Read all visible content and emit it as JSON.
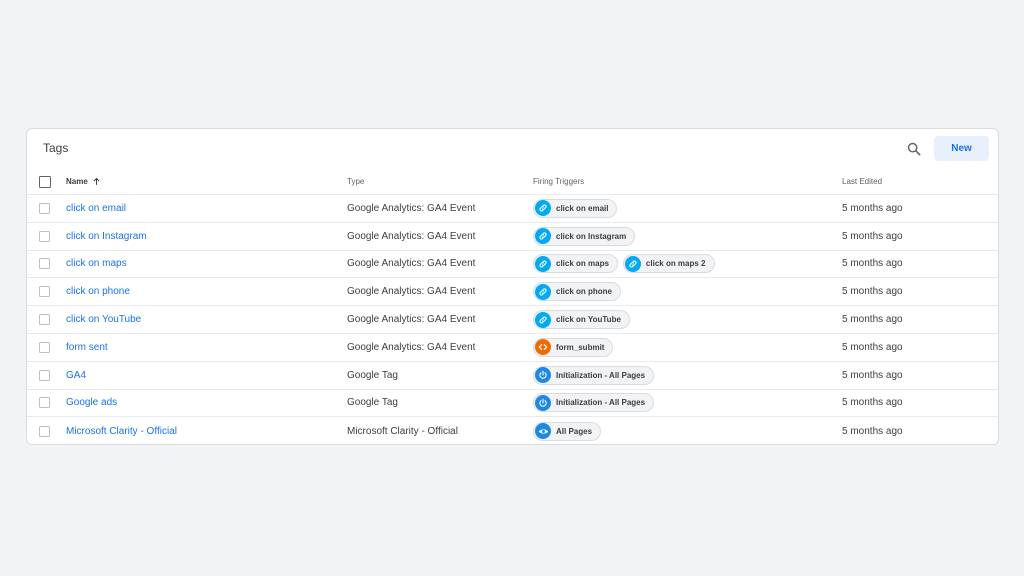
{
  "card": {
    "title": "Tags",
    "new_label": "New"
  },
  "columns": {
    "name": "Name",
    "type": "Type",
    "triggers": "Firing Triggers",
    "last_edited": "Last Edited"
  },
  "icons": {
    "search": "search-icon",
    "sort": "arrow-up-icon",
    "link": "link-icon",
    "code": "code-icon",
    "power": "power-icon",
    "eye": "eye-icon"
  },
  "colors": {
    "link": "#1a73e8",
    "trigger_link": "#03a9f4",
    "trigger_code": "#ef6c00",
    "trigger_power": "#1e88e5",
    "trigger_eye": "#1e88e5",
    "new_button_bg": "#e8f0fe"
  },
  "rows": [
    {
      "name": "click on email",
      "type": "Google Analytics: GA4 Event",
      "triggers": [
        {
          "label": "click on email",
          "icon": "link"
        }
      ],
      "last_edited": "5 months ago"
    },
    {
      "name": "click on Instagram",
      "type": "Google Analytics: GA4 Event",
      "triggers": [
        {
          "label": "click on Instagram",
          "icon": "link"
        }
      ],
      "last_edited": "5 months ago"
    },
    {
      "name": "click on maps",
      "type": "Google Analytics: GA4 Event",
      "triggers": [
        {
          "label": "click on maps",
          "icon": "link"
        },
        {
          "label": "click on maps 2",
          "icon": "link"
        }
      ],
      "last_edited": "5 months ago"
    },
    {
      "name": "click on phone",
      "type": "Google Analytics: GA4 Event",
      "triggers": [
        {
          "label": "click on phone",
          "icon": "link"
        }
      ],
      "last_edited": "5 months ago"
    },
    {
      "name": "click on YouTube",
      "type": "Google Analytics: GA4 Event",
      "triggers": [
        {
          "label": "click on YouTube",
          "icon": "link"
        }
      ],
      "last_edited": "5 months ago"
    },
    {
      "name": "form sent",
      "type": "Google Analytics: GA4 Event",
      "triggers": [
        {
          "label": "form_submit",
          "icon": "code"
        }
      ],
      "last_edited": "5 months ago"
    },
    {
      "name": "GA4",
      "type": "Google Tag",
      "triggers": [
        {
          "label": "Initialization - All Pages",
          "icon": "power"
        }
      ],
      "last_edited": "5 months ago"
    },
    {
      "name": "Google ads",
      "type": "Google Tag",
      "triggers": [
        {
          "label": "Initialization - All Pages",
          "icon": "power"
        }
      ],
      "last_edited": "5 months ago"
    },
    {
      "name": "Microsoft Clarity - Official",
      "type": "Microsoft Clarity - Official",
      "triggers": [
        {
          "label": "All Pages",
          "icon": "eye"
        }
      ],
      "last_edited": "5 months ago"
    }
  ]
}
